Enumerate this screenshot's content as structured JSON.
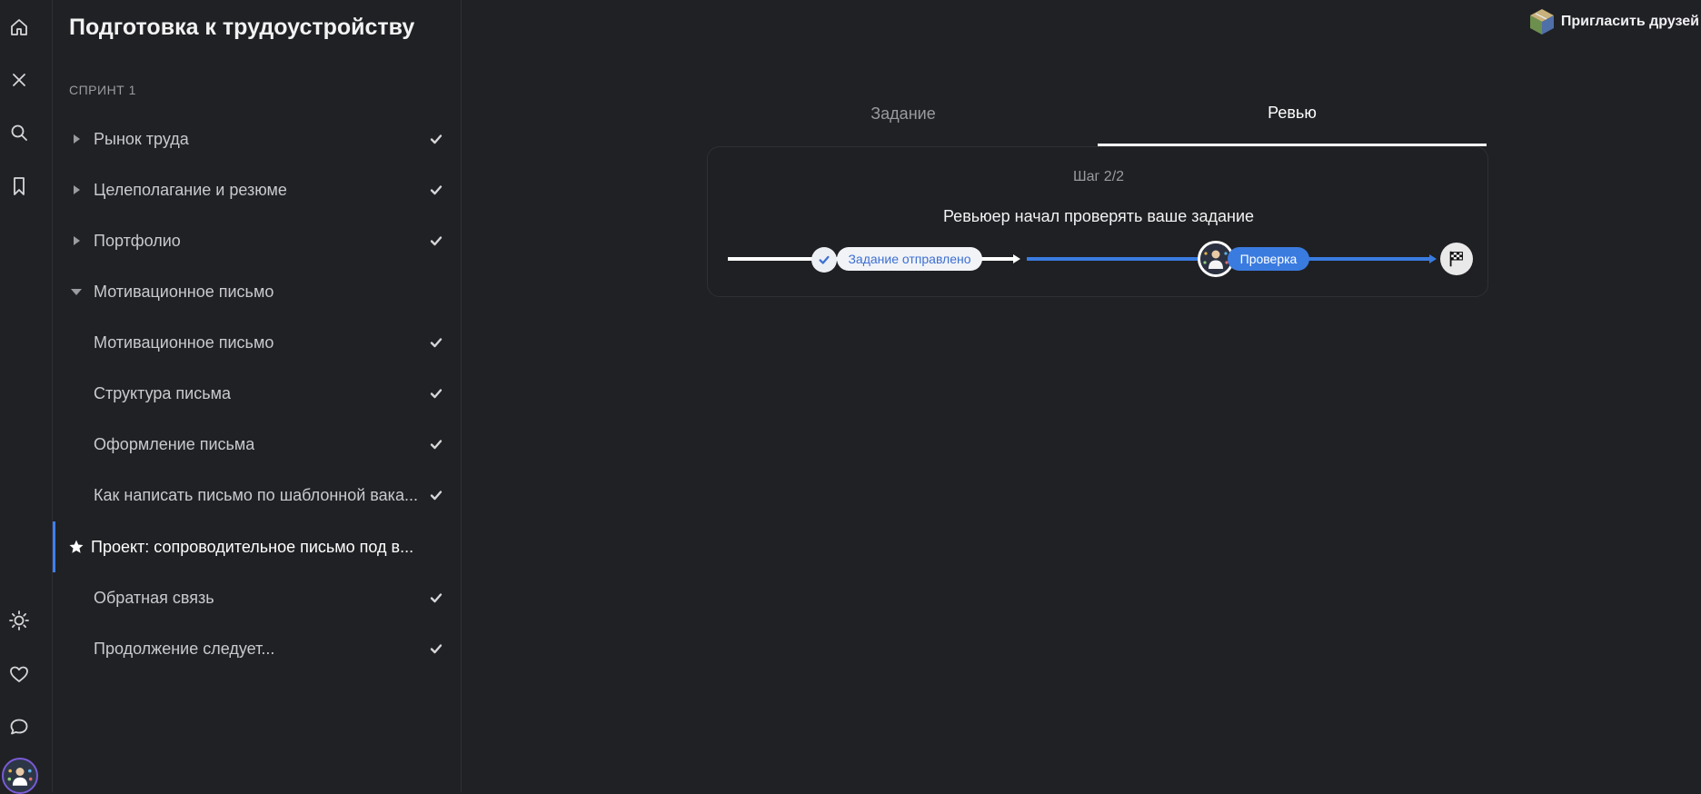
{
  "rail": {
    "icons": [
      "home-icon",
      "close-icon",
      "search-icon",
      "bookmark-icon",
      "sun-icon",
      "heart-icon",
      "chat-icon"
    ]
  },
  "sidebar": {
    "title": "Подготовка к трудоустройству",
    "sprint": "СПРИНТ 1",
    "items": [
      {
        "label": "Рынок труда",
        "state": "collapsed",
        "done": true
      },
      {
        "label": "Целеполагание и резюме",
        "state": "collapsed",
        "done": true
      },
      {
        "label": "Портфолио",
        "state": "collapsed",
        "done": true
      },
      {
        "label": "Мотивационное письмо",
        "state": "expanded",
        "done": false
      },
      {
        "label": "Мотивационное письмо",
        "state": "child",
        "done": true
      },
      {
        "label": "Структура письма",
        "state": "child",
        "done": true
      },
      {
        "label": "Оформление письма",
        "state": "child",
        "done": true
      },
      {
        "label": "Как написать письмо по шаблонной вака...",
        "state": "child",
        "done": true
      },
      {
        "label": "Проект: сопроводительное письмо под в...",
        "state": "active",
        "done": false
      },
      {
        "label": "Обратная связь",
        "state": "child",
        "done": true
      },
      {
        "label": "Продолжение следует...",
        "state": "child",
        "done": true
      }
    ]
  },
  "header": {
    "invite_label": "Пригласить друзей"
  },
  "tabs": {
    "task": "Задание",
    "review": "Ревью",
    "selected": "review"
  },
  "review": {
    "step": "Шаг 2/2",
    "status": "Ревьюер начал проверять ваше задание",
    "sent_label": "Задание отправлено",
    "checking_label": "Проверка"
  },
  "colors": {
    "background": "#202124",
    "accent": "#3a7be0",
    "active_bar": "#3d7ff6"
  }
}
